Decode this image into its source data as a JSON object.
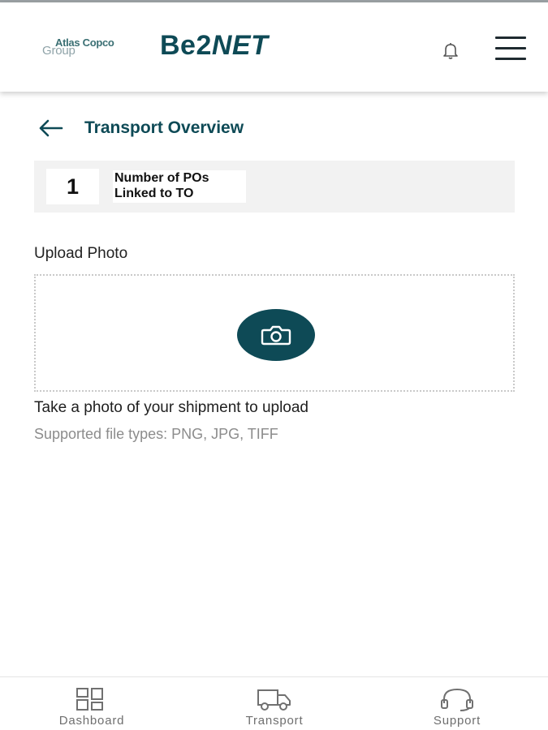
{
  "header": {
    "logo_line1": "Atlas Copco",
    "logo_line2": "Group",
    "brand_prefix": "Be2",
    "brand_suffix": "NET",
    "notifications_icon": "bell-icon",
    "menu_icon": "hamburger-menu-icon"
  },
  "page": {
    "back_icon": "arrow-left-icon",
    "title": "Transport Overview"
  },
  "po_summary": {
    "count": "1",
    "label_line1": "Number of POs",
    "label_line2": "Linked to TO"
  },
  "upload": {
    "label": "Upload Photo",
    "camera_icon": "camera-icon",
    "hint": "Take a photo of your shipment to upload",
    "supported_types": "Supported file types: PNG, JPG, TIFF"
  },
  "bottom_nav": {
    "items": [
      {
        "label": "Dashboard",
        "icon": "dashboard-grid-icon"
      },
      {
        "label": "Transport",
        "icon": "truck-icon"
      },
      {
        "label": "Support",
        "icon": "headset-icon"
      }
    ]
  },
  "colors": {
    "brand": "#0e4a56",
    "card_bg": "#f2f2f2",
    "muted_text": "#8c8c8c"
  }
}
